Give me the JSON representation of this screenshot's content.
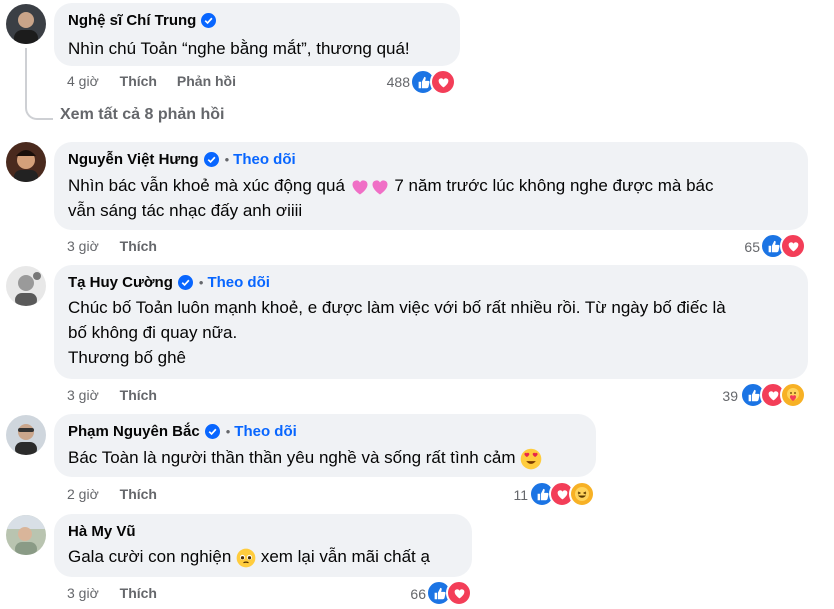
{
  "comments": [
    {
      "name": "Nghệ sĩ Chí Trung",
      "verified": true,
      "follow": "",
      "lines": [
        "Nhìn chú Toản “nghe bằng mắt”, thương quá!"
      ],
      "time": "4 giờ",
      "like": "Thích",
      "reply": "Phản hồi",
      "count": "488",
      "reactions": [
        "like",
        "love"
      ]
    },
    {
      "name": "Nguyễn Việt Hưng",
      "verified": true,
      "follow": "Theo dõi",
      "lines": [
        "Nhìn bác vẫn khoẻ mà xúc động quá",
        "vẫn sáng tác nhạc đấy anh ơiiii"
      ],
      "line1_tail": "7 năm trước lúc không nghe được mà bác",
      "time": "3 giờ",
      "like": "Thích",
      "count": "65",
      "reactions": [
        "like",
        "love"
      ]
    },
    {
      "name": "Tạ Huy Cường",
      "verified": true,
      "follow": "Theo dõi",
      "lines": [
        "Chúc bố Toản luôn mạnh khoẻ, e được làm việc với bố rất nhiều rồi. Từ ngày bố điếc là",
        "bố không đi quay nữa.",
        "Thương bố ghê"
      ],
      "time": "3 giờ",
      "like": "Thích",
      "count": "39",
      "reactions": [
        "like",
        "love",
        "care"
      ]
    },
    {
      "name": "Phạm Nguyên Bắc",
      "verified": true,
      "follow": "Theo dõi",
      "lines": [
        "Bác Toàn là người thần thần yêu nghề và sống rất tình cảm"
      ],
      "time": "2 giờ",
      "like": "Thích",
      "count": "11",
      "reactions": [
        "like",
        "love",
        "haha"
      ]
    },
    {
      "name": "Hà My Vũ",
      "verified": false,
      "follow": "",
      "lines": [
        "Gala cười con nghiện",
        "xem lại vẫn mãi chất ạ"
      ],
      "time": "3 giờ",
      "like": "Thích",
      "count": "66",
      "reactions": [
        "like",
        "love"
      ]
    }
  ],
  "see_all_replies": "Xem tất cả 8 phản hồi",
  "colors": {
    "bubble": "#f0f2f5",
    "link": "#0866ff",
    "muted": "#65676b",
    "like": "#1b74e4",
    "love": "#f33e58"
  }
}
